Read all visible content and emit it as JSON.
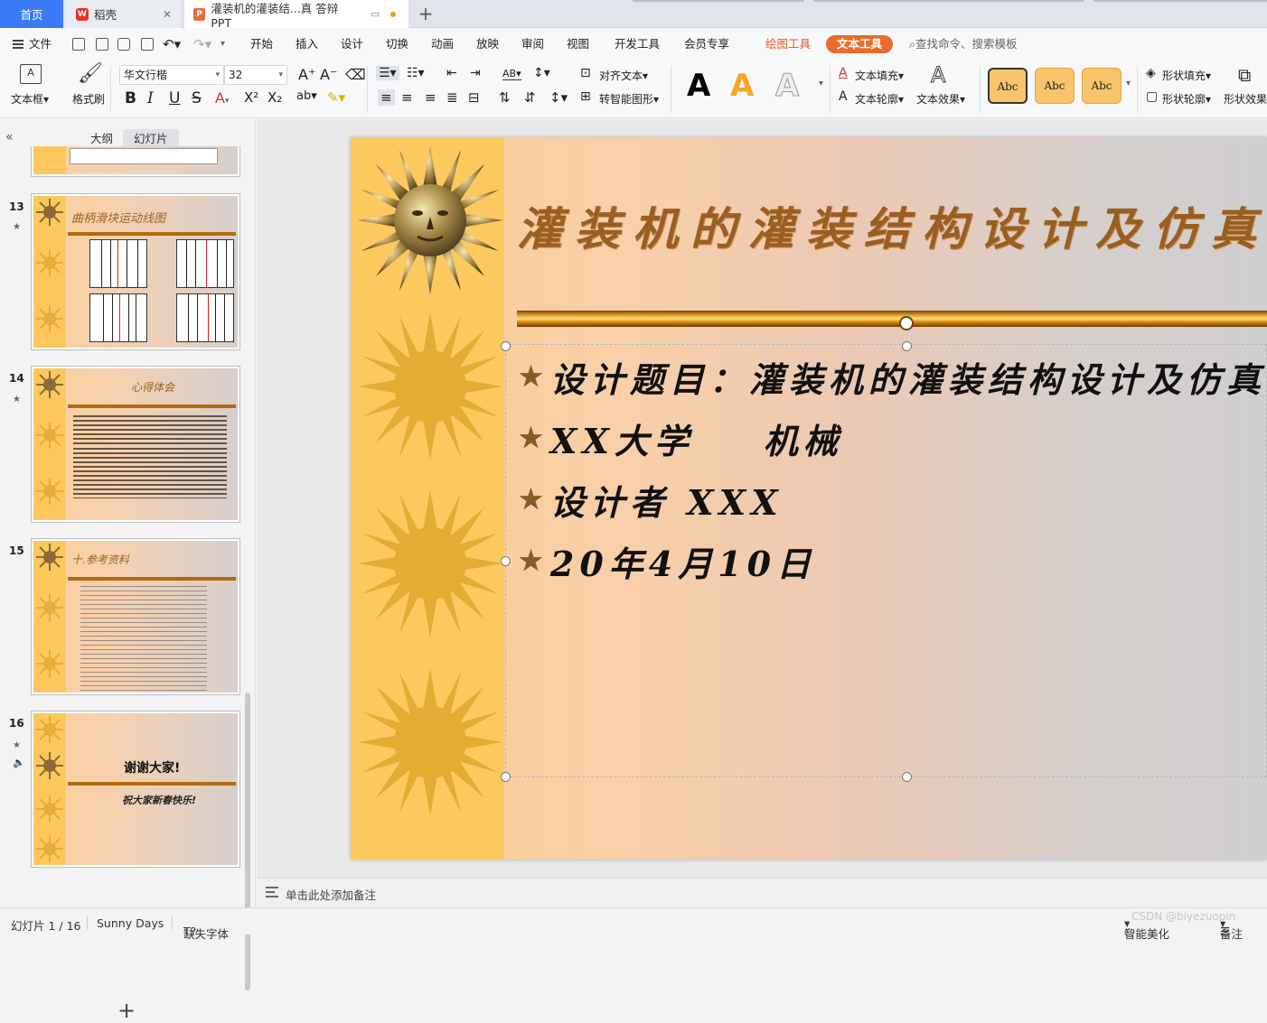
{
  "tabs": {
    "home": "首页",
    "wps": "稻壳",
    "doc": "灌装机的灌装结...真 答辩PPT"
  },
  "menu": {
    "file": "文件",
    "items": [
      "开始",
      "插入",
      "设计",
      "切换",
      "动画",
      "放映",
      "审阅",
      "视图",
      "开发工具",
      "会员专享"
    ],
    "draw_tool": "绘图工具",
    "text_tool": "文本工具",
    "search": "查找命令、搜索模板"
  },
  "ribbon": {
    "textbox": "文本框",
    "format_painter": "格式刷",
    "font_name": "华文行楷",
    "font_size": "32",
    "align_text": "对齐文本",
    "smart_shape": "转智能图形",
    "text_fill": "文本填充",
    "text_outline": "文本轮廓",
    "text_effect": "文本效果",
    "abc1": "Abc",
    "abc2": "Abc",
    "abc3": "Abc",
    "shape_fill": "形状填充",
    "shape_outline": "形状轮廓",
    "shape_effect": "形状效果"
  },
  "panel": {
    "tab_outline": "大纲",
    "tab_slides": "幻灯片"
  },
  "thumbnails": [
    {
      "num": "13",
      "title": "曲柄滑块运动线图"
    },
    {
      "num": "14",
      "title": "心得体会"
    },
    {
      "num": "15",
      "title": "十.参考资料"
    },
    {
      "num": "16",
      "title": "谢谢大家!",
      "subtitle": "祝大家新春快乐!"
    }
  ],
  "slide": {
    "title": "灌装机的灌装结构设计及仿真",
    "bullets": [
      "设计题目：灌装机的灌装结构设计及仿真",
      "XX大学    机械",
      "设计者 XXX",
      "20年4月10日"
    ]
  },
  "notes_placeholder": "单击此处添加备注",
  "status": {
    "slide_count": "幻灯片 1 / 16",
    "theme": "Sunny Days",
    "missing_font": "缺失字体",
    "smart_beautify": "智能美化",
    "notes": "备注"
  },
  "watermark": "CSDN @biyezuopin",
  "colors": {
    "accent": "#3a7bf5",
    "text_tool": "#ea6b2c",
    "slide_title": "#9b5e22",
    "strip": "#fcc95f"
  }
}
